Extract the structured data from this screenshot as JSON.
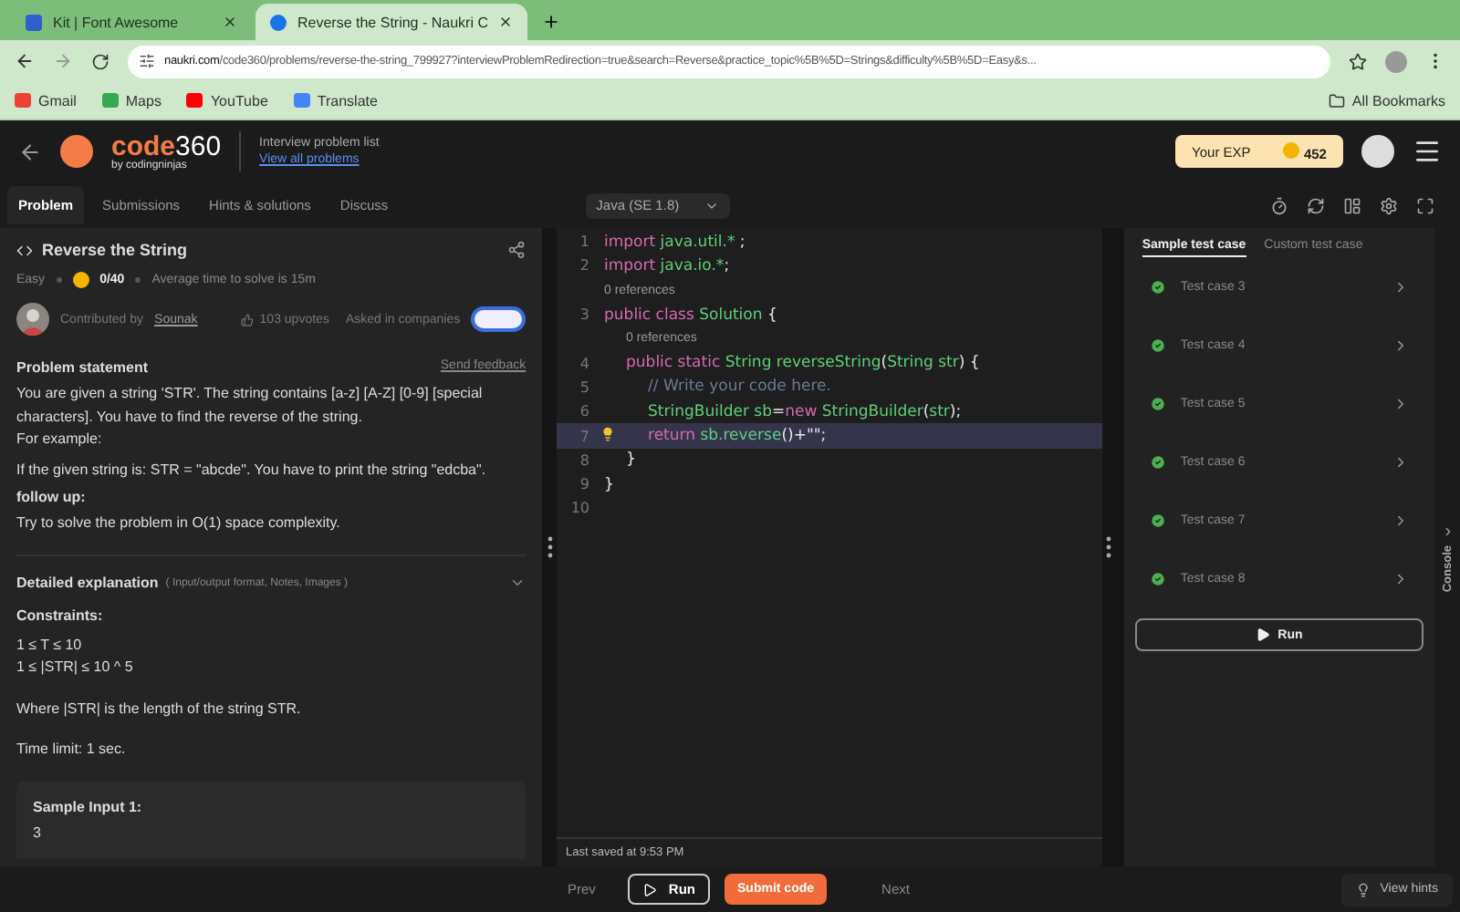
{
  "browser": {
    "tabs": [
      {
        "title": "Kit | Font Awesome",
        "selected": false
      },
      {
        "title": "Reverse the String - Naukri C",
        "selected": true
      }
    ],
    "url_host": "naukri.com",
    "url_path": "/code360/problems/reverse-the-string_799927?interviewProblemRedirection=true&search=Reverse&practice_topic%5B%5D=Strings&difficulty%5B%5D=Easy&s...",
    "bookmarks": [
      "Gmail",
      "Maps",
      "YouTube",
      "Translate"
    ],
    "all_bookmarks": "All Bookmarks"
  },
  "header": {
    "logo_main": "code",
    "logo_num": "360",
    "logo_sub": "by codingninjas",
    "crumb_title": "Interview problem list",
    "crumb_link": "View all problems",
    "exp_label": "Your EXP",
    "exp_value": "452"
  },
  "panel_tabs": [
    {
      "label": "Problem",
      "selected": true
    },
    {
      "label": "Submissions",
      "selected": false
    },
    {
      "label": "Hints & solutions",
      "selected": false
    },
    {
      "label": "Discuss",
      "selected": false
    }
  ],
  "language": "Java (SE 1.8)",
  "problem": {
    "title": "Reverse the String",
    "difficulty": "Easy",
    "score": "0/40",
    "avg_time": "Average time to solve is 15m",
    "contributed_label": "Contributed by",
    "contributor": "Sounak",
    "upvotes": "103 upvotes",
    "asked_label": "Asked in companies",
    "statement_heading": "Problem statement",
    "feedback": "Send feedback",
    "statement": [
      "You are given a string 'STR'. The string contains [a-z] [A-Z] [0-9] [special characters]. You have to find the reverse of the string.",
      "For example:"
    ],
    "example": " If the given string is: STR = \"abcde\". You have to print the string \"edcba\".",
    "followup_heading": "follow up:",
    "followup": "Try to solve the problem in O(1) space complexity.",
    "detail_heading": "Detailed explanation",
    "detail_hint": "( Input/output format, Notes, Images )",
    "constraints_heading": "Constraints:",
    "constraints": [
      "1 ≤ T ≤ 10",
      "1 ≤ |STR| ≤ 10 ^ 5"
    ],
    "where": "Where |STR| is the length of the string STR.",
    "time_limit": "Time limit: 1 sec.",
    "sample_heading": "Sample Input 1:",
    "sample_value": "3"
  },
  "code": [
    {
      "kind": "line",
      "number": "1",
      "highlight": false,
      "tokens": [
        {
          "kind": "keyword",
          "text": "import "
        },
        {
          "kind": "type",
          "text": "java.util.* "
        },
        {
          "kind": "plain",
          "text": ";"
        }
      ]
    },
    {
      "kind": "line",
      "number": "2",
      "highlight": false,
      "tokens": [
        {
          "kind": "keyword",
          "text": "import "
        },
        {
          "kind": "type",
          "text": "java.io.*"
        },
        {
          "kind": "plain",
          "text": ";"
        }
      ]
    },
    {
      "kind": "refs",
      "text": "0 references"
    },
    {
      "kind": "line",
      "number": "3",
      "highlight": false,
      "tokens": [
        {
          "kind": "keyword",
          "text": "public class "
        },
        {
          "kind": "type",
          "text": "Solution "
        },
        {
          "kind": "plain",
          "text": "{"
        }
      ],
      "children": [
        {
          "kind": "refs",
          "text": "0 references"
        },
        {
          "kind": "line",
          "number": "4",
          "highlight": false,
          "tokens": [
            {
              "kind": "keyword",
              "text": "public static "
            },
            {
              "kind": "type",
              "text": "String reverseString"
            },
            {
              "kind": "plain",
              "text": "("
            },
            {
              "kind": "type",
              "text": "String str"
            },
            {
              "kind": "plain",
              "text": ") {"
            }
          ],
          "children": [
            {
              "kind": "line",
              "number": "5",
              "highlight": false,
              "tokens": [
                {
                  "kind": "comment",
                  "text": "// Write your code here."
                }
              ]
            },
            {
              "kind": "line",
              "number": "6",
              "highlight": false,
              "tokens": [
                {
                  "kind": "type",
                  "text": "StringBuilder sb"
                },
                {
                  "kind": "plain",
                  "text": "="
                },
                {
                  "kind": "keyword",
                  "text": "new "
                },
                {
                  "kind": "type",
                  "text": "StringBuilder"
                },
                {
                  "kind": "plain",
                  "text": "("
                },
                {
                  "kind": "type",
                  "text": "str"
                },
                {
                  "kind": "plain",
                  "text": ");"
                }
              ]
            },
            {
              "kind": "line",
              "number": "7",
              "highlight": true,
              "tokens": [
                {
                  "kind": "keyword",
                  "text": "return "
                },
                {
                  "kind": "type",
                  "text": "sb.reverse"
                },
                {
                  "kind": "plain",
                  "text": "()+\"\";"
                }
              ]
            }
          ]
        },
        {
          "kind": "line",
          "number": "8",
          "highlight": false,
          "tokens": [
            {
              "kind": "plain",
              "text": "}"
            }
          ]
        }
      ]
    },
    {
      "kind": "line",
      "number": "9",
      "highlight": false,
      "tokens": [
        {
          "kind": "plain",
          "text": "}"
        }
      ]
    },
    {
      "kind": "line",
      "number": "10",
      "highlight": false
    }
  ],
  "last_saved": "Last saved at 9:53 PM",
  "test_tabs": [
    {
      "label": "Sample test case",
      "selected": true
    },
    {
      "label": "Custom test case",
      "selected": false
    }
  ],
  "test_cases": [
    {
      "label": "Test case 3",
      "passed": true
    },
    {
      "label": "Test case 4",
      "passed": true
    },
    {
      "label": "Test case 5",
      "passed": true
    },
    {
      "label": "Test case 6",
      "passed": true
    },
    {
      "label": "Test case 7",
      "passed": true
    },
    {
      "label": "Test case 8",
      "passed": true
    }
  ],
  "run_label": "Run",
  "console_label": "Console",
  "footer": {
    "prev": "Prev",
    "run": "Run",
    "submit": "Submit code",
    "next": "Next",
    "hints": "View hints"
  }
}
